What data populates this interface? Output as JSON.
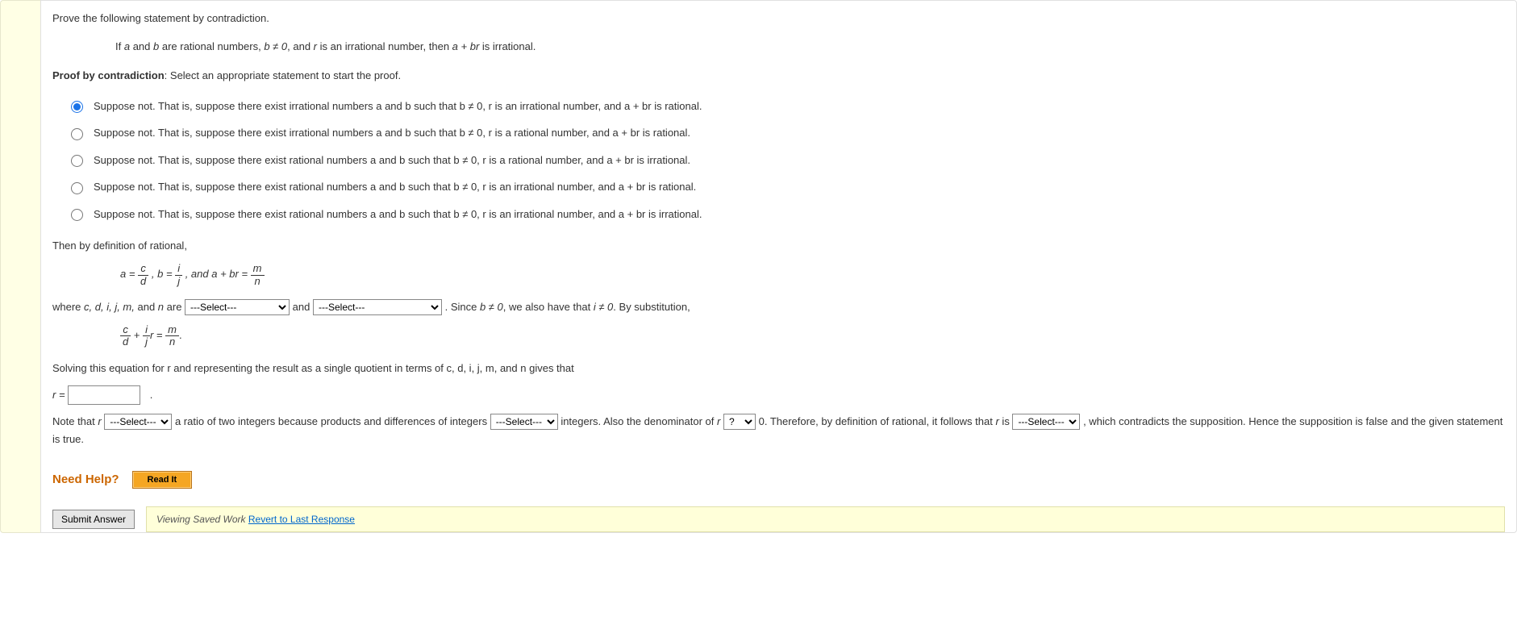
{
  "prompt": "Prove the following statement by contradiction.",
  "theorem": {
    "pre": "If ",
    "a": "a",
    "mid1": " and ",
    "b": "b",
    "mid2": " are rational numbers, ",
    "cond": "b ≠ 0",
    "mid3": ", and ",
    "r": "r",
    "mid4": " is an irrational number, then ",
    "expr": "a + br",
    "end": " is irrational."
  },
  "proof_start": "Proof by contradiction",
  "proof_start_tail": ": Select an appropriate statement to start the proof.",
  "options": [
    "Suppose not. That is, suppose there exist irrational numbers a and b such that b ≠ 0, r is an irrational number, and a + br is rational.",
    "Suppose not. That is, suppose there exist irrational numbers a and b such that b ≠ 0, r is a rational number, and a + br is rational.",
    "Suppose not. That is, suppose there exist rational numbers a and b such that b ≠ 0, r is a rational number, and a + br is irrational.",
    "Suppose not. That is, suppose there exist rational numbers a and b such that b ≠ 0, r is an irrational number, and a + br is rational.",
    "Suppose not. That is, suppose there exist rational numbers a and b such that b ≠ 0, r is an irrational number, and a + br is irrational."
  ],
  "selected_option": 0,
  "then_def": "Then by definition of rational,",
  "eqs": {
    "a_eq": "a = ",
    "frac1_num": "c",
    "frac1_den": "d",
    "comma_b": ", b = ",
    "frac2_num": "i",
    "frac2_den": "j",
    "and_abr": ", and a + br = ",
    "frac3_num": "m",
    "frac3_den": "n"
  },
  "where_line": {
    "pre": "where ",
    "vars": "c, d, i, j, m,",
    "and_n": " and ",
    "n": "n",
    "are": " are ",
    "select_placeholder": "---Select---",
    "and": " and ",
    "since": ". Since ",
    "bneq": "b ≠ 0",
    "also": ", we also have that ",
    "ineq": "i ≠ 0",
    "bysub": ". By substitution,"
  },
  "eq2": {
    "f1n": "c",
    "f1d": "d",
    "plus": " + ",
    "f2n": "i",
    "f2d": "j",
    "r": "r",
    " eq": " = ",
    "f3n": "m",
    "f3d": "n",
    "dot": "."
  },
  "solving": "Solving this equation for r and representing the result as a single quotient in terms of c, d, i, j, m, and n gives that",
  "r_eq_label": "r = ",
  "r_tail": ".",
  "note": {
    "p1": "Note that ",
    "r": "r",
    "sel": "---Select---",
    "p2": " a ratio of two integers because products and differences of integers ",
    "p3": " integers. Also the denominator of ",
    "qsel": "?",
    "p4": " 0. Therefore, by definition of rational, it follows that ",
    "is": " is ",
    "p5": ", which contradicts the supposition. Hence the supposition is false and the given statement is true."
  },
  "need_help": "Need Help?",
  "read_it": "Read It",
  "submit": "Submit Answer",
  "saved_work_prefix": "Viewing Saved Work ",
  "revert": "Revert to Last Response"
}
